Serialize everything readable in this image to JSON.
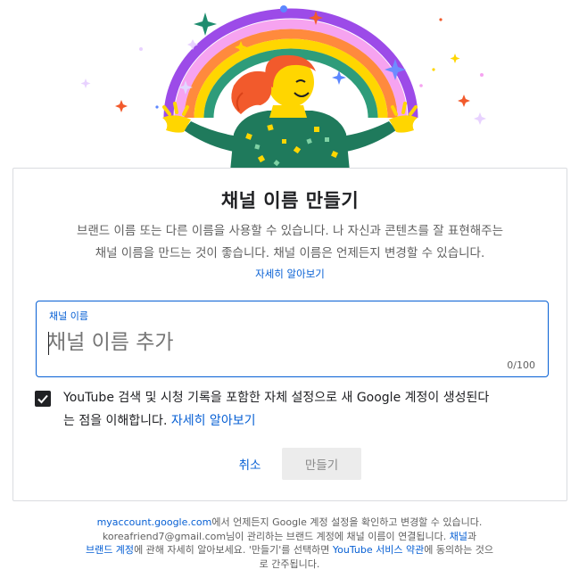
{
  "dialog": {
    "title": "채널 이름 만들기",
    "description_line1": "브랜드 이름 또는 다른 이름을 사용할 수 있습니다. 나 자신과 콘텐츠를 잘 표현해주는",
    "description_line2": "채널 이름을 만드는 것이 좋습니다. 채널 이름은 언제든지 변경할 수 있습니다.",
    "learn_more": "자세히 알아보기",
    "field": {
      "label": "채널 이름",
      "value": "",
      "placeholder": "채널 이름 추가",
      "counter": "0/100"
    },
    "consent": {
      "checked": true,
      "text_line1": "YouTube 검색 및 시청 기록을 포함한 자체 설정으로 새 Google 계정이 생성된다",
      "text_line2": "는 점을 이해합니다. ",
      "learn_more": "자세히 알아보기"
    },
    "buttons": {
      "cancel": "취소",
      "create": "만들기"
    }
  },
  "footer": {
    "l1_link": "myaccount.google.com",
    "l1_text": "에서 언제든지 Google 계정 설정을 확인하고 변경할 수 있습니다.",
    "l2_text": "koreafriend7@gmail.com님이 관리하는 브랜드 계정에 채널 이름이 연결됩니다. ",
    "l2_link": "채널",
    "l2_tail": "과",
    "l3_link1": "브랜드 계정",
    "l3_text": "에 관해 자세히 알아보세요. '만들기'를 선택하면 ",
    "l3_link2": "YouTube 서비스 약관",
    "l3_tail": "에 동의하는 것으",
    "l4_text": "로 간주됩니다."
  },
  "colors": {
    "accent": "#065fd4",
    "border": "#dadce0",
    "disabled_button_bg": "#ececec"
  }
}
